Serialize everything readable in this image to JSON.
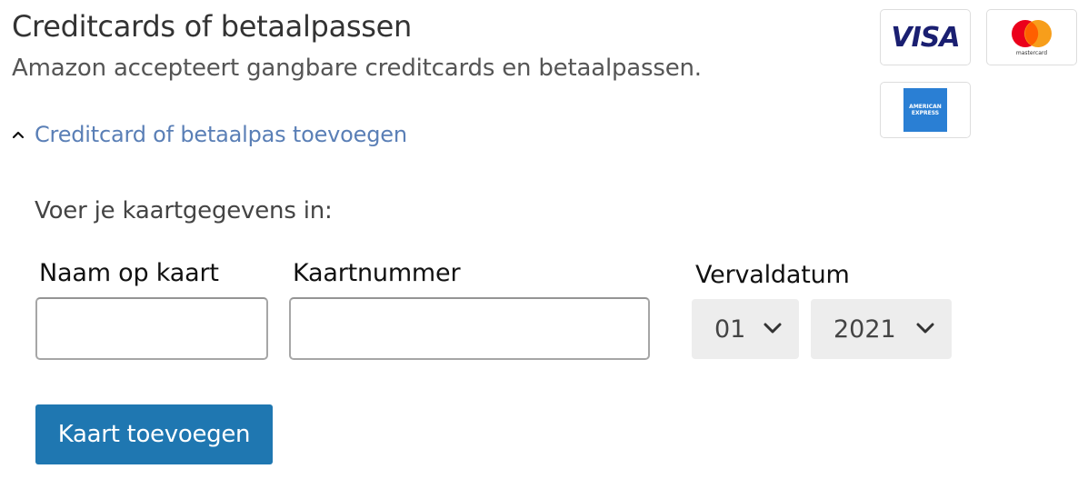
{
  "section": {
    "title": "Creditcards of betaalpassen",
    "subtitle": "Amazon accepteert gangbare creditcards en betaalpassen."
  },
  "expander": {
    "icon": "caret-up-icon",
    "link_text": "Creditcard of betaalpas toevoegen"
  },
  "card_logos": {
    "visa": "VISA",
    "mastercard": "mastercard",
    "amex_line1": "AMERICAN",
    "amex_line2": "EXPRESS",
    "colors": {
      "visa": "#1a1f71",
      "mastercard_red": "#eb001b",
      "mastercard_orange": "#f79e1b",
      "amex": "#2a7fd4"
    }
  },
  "form": {
    "intro": "Voer je kaartgegevens in:",
    "name_label": "Naam op kaart",
    "name_value": "",
    "number_label": "Kaartnummer",
    "number_value": "",
    "expiry_label": "Vervaldatum",
    "month_selected": "01",
    "year_selected": "2021",
    "dropdown_icon": "chevron-down-icon"
  },
  "actions": {
    "submit_label": "Kaart toevoegen",
    "primary_color": "#1f77b1"
  }
}
